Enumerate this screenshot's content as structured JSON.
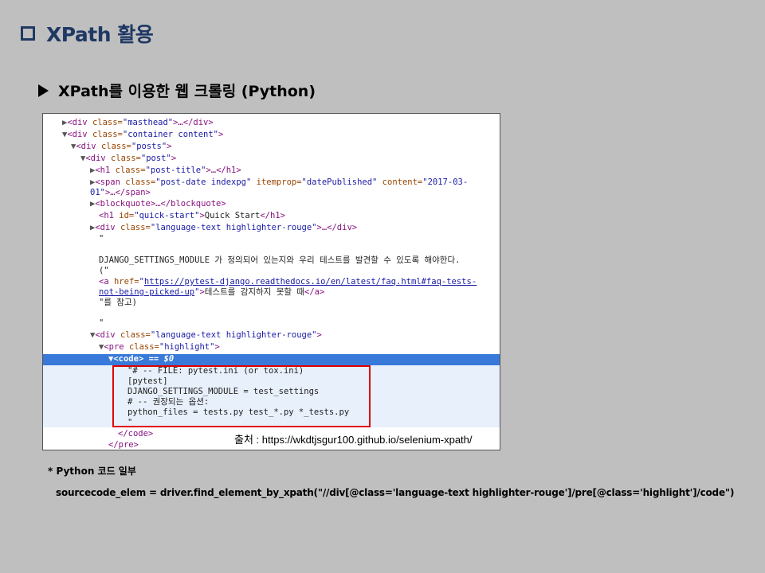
{
  "header": {
    "title": "XPath 활용"
  },
  "subtitle": "XPath를 이용한 웹 크롤링 (Python)",
  "dom": {
    "l1": {
      "open": "<div",
      "attr": " class=",
      "val": "\"masthead\"",
      "rest": ">…</div>"
    },
    "l2": {
      "open": "<div",
      "attr": " class=",
      "val": "\"container content\"",
      "rest": ">"
    },
    "l3": {
      "open": "<div",
      "attr": " class=",
      "val": "\"posts\"",
      "rest": ">"
    },
    "l4": {
      "open": "<div",
      "attr": " class=",
      "val": "\"post\"",
      "rest": ">"
    },
    "l5": {
      "open": "<h1",
      "attr": " class=",
      "val": "\"post-title\"",
      "rest": ">…</h1>"
    },
    "l6a": {
      "open": "<span",
      "attr": " class=",
      "val": "\"post-date indexpg\"",
      "attr2": " itemprop=",
      "val2": "\"datePublished\"",
      "attr3": " content=",
      "val3": "\"2017-03-"
    },
    "l6b": {
      "val": "01\"",
      "rest": ">…</span>"
    },
    "l7": {
      "open": "<blockquote",
      "rest": ">…</blockquote>"
    },
    "l8": {
      "open": "<h1",
      "attr": " id=",
      "val": "\"quick-start\"",
      "mid": ">",
      "text": "Quick Start",
      "close": "</h1>"
    },
    "l9": {
      "open": "<div",
      "attr": " class=",
      "val": "\"language-text highlighter-rouge\"",
      "rest": ">…</div>"
    },
    "l10": "\"",
    "l11": "DJANGO_SETTINGS_MODULE 가 정의되어 있는지와 우리 테스트를 발견할 수 있도록 해야한다.",
    "l12": "(\"",
    "l13": {
      "open": "<a",
      "attr": " href=",
      "q": "\"",
      "link1": "https://pytest-django.readthedocs.io/en/latest/faq.html#faq-tests-"
    },
    "l14": {
      "link2": "not-being-picked-up",
      "q": "\"",
      "mid": ">",
      "text": "테스트를 감지하지 못할 때",
      "close": "</a>"
    },
    "l15": "\"를 참고)",
    "l16": "\"",
    "l17": {
      "open": "<div",
      "attr": " class=",
      "val": "\"language-text highlighter-rouge\"",
      "rest": ">"
    },
    "l18": {
      "open": "<pre",
      "attr": " class=",
      "val": "\"highlight\"",
      "rest": ">"
    },
    "l19": {
      "open": "<code",
      "rest": "> == $0"
    },
    "code": [
      "\"# -- FILE: pytest.ini (or tox.ini)",
      "[pytest]",
      "DJANGO_SETTINGS_MODULE = test_settings",
      "# -- 권장되는 옵션:",
      "python_files = tests.py test_*.py *_tests.py",
      "\""
    ],
    "l26": "</code>",
    "l27": "</pre>"
  },
  "source_note": "출처 : https://wkdtjsgur100.github.io/selenium-xpath/",
  "note1": "* Python 코드 일부",
  "note2": "sourcecode_elem  =  driver.find_element_by_xpath(\"//div[@class='language-text   highlighter-rouge']/pre[@class='highlight']/code\")",
  "colors": {
    "title": "#1f3864",
    "background": "#bfbfbf",
    "selection": "#3879d9",
    "highlight_box": "#e00000"
  }
}
